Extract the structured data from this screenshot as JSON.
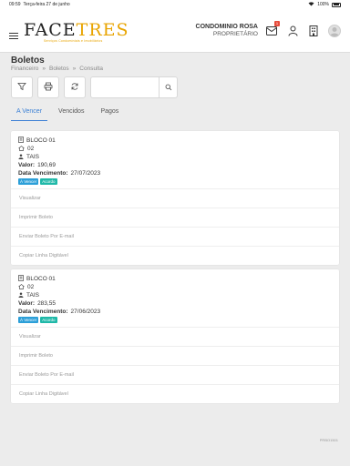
{
  "status_bar": {
    "time": "09:59",
    "date": "Terça-feira 27 de junho",
    "battery": "100%"
  },
  "header": {
    "logo_main_a": "FACE",
    "logo_main_b": "TRES",
    "logo_sub": "Serviços Condominiais e Imobiliários",
    "condo_name": "CONDOMINIO ROSA",
    "condo_role": "PROPRIETÁRIO",
    "badge_count": "1"
  },
  "page": {
    "title": "Boletos",
    "breadcrumb": [
      "Financeiro",
      "»",
      "Boletos",
      "»",
      "Consulta"
    ]
  },
  "search": {
    "placeholder": "",
    "value": ""
  },
  "tabs": [
    {
      "label": "A Vencer",
      "active": true
    },
    {
      "label": "Vencidos",
      "active": false
    },
    {
      "label": "Pagos",
      "active": false
    }
  ],
  "cards": [
    {
      "bloco": "BLOCO 01",
      "unidade": "02",
      "nome": "TAIS",
      "valor_label": "Valor:",
      "valor": "190,69",
      "venc_label": "Data Vencimento:",
      "vencimento": "27/07/2023",
      "tags": [
        "À Vencer",
        "Acordo"
      ],
      "actions": [
        "Visualizar",
        "Imprimir Boleto",
        "Enviar Boleto Por E-mail",
        "Copiar Linha Digitável"
      ]
    },
    {
      "bloco": "BLOCO 01",
      "unidade": "02",
      "nome": "TAIS",
      "valor_label": "Valor:",
      "valor": "283,55",
      "venc_label": "Data Vencimento:",
      "vencimento": "27/06/2023",
      "tags": [
        "À Vencer",
        "Acordo"
      ],
      "actions": [
        "Visualizar",
        "Imprimir Boleto",
        "Enviar Boleto Por E-mail",
        "Copiar Linha Digitável"
      ]
    }
  ],
  "footer_code": "PRBO1501",
  "colors": {
    "accent": "#3a7fd5",
    "tag_blue": "#2c9fd8",
    "tag_teal": "#1fb8a8",
    "logo_gold": "#e8a400"
  }
}
